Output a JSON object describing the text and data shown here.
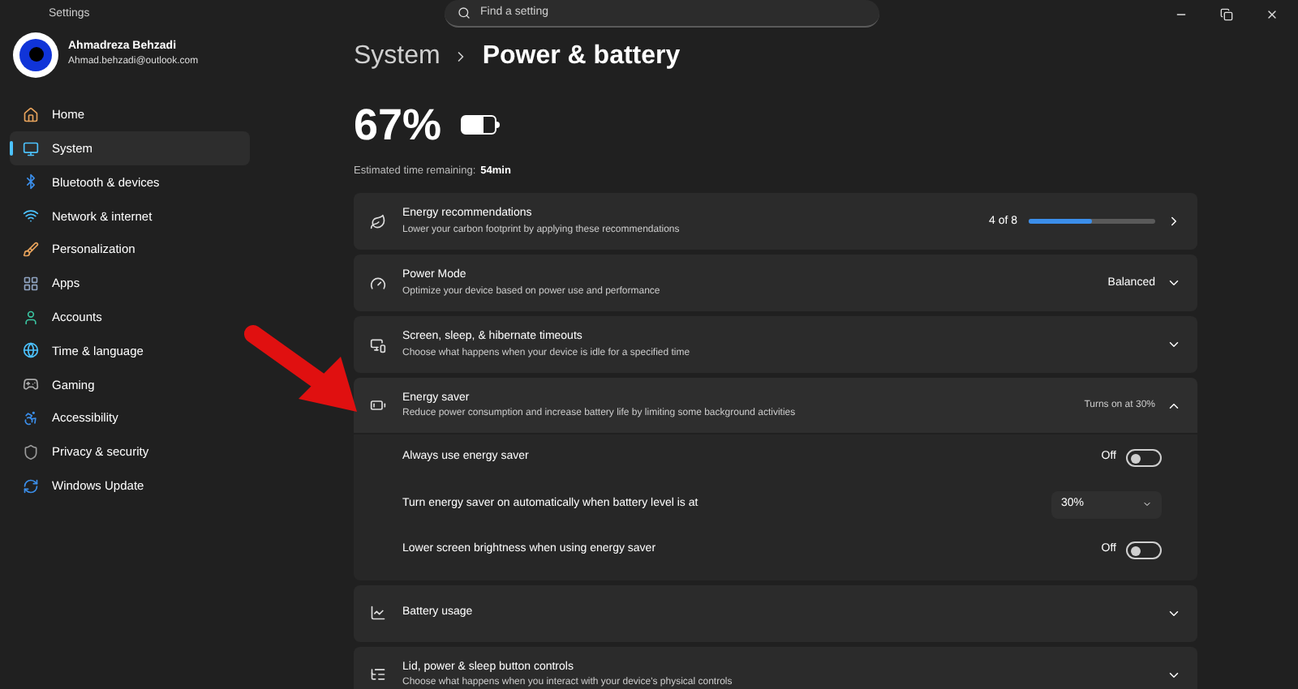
{
  "window": {
    "title": "Settings"
  },
  "user": {
    "name": "Ahmadreza Behzadi",
    "email": "Ahmad.behzadi@outlook.com"
  },
  "search": {
    "placeholder": "Find a setting"
  },
  "sidebar": {
    "items": [
      {
        "label": "Home",
        "selected": false
      },
      {
        "label": "System",
        "selected": true
      },
      {
        "label": "Bluetooth & devices",
        "selected": false
      },
      {
        "label": "Network & internet",
        "selected": false
      },
      {
        "label": "Personalization",
        "selected": false
      },
      {
        "label": "Apps",
        "selected": false
      },
      {
        "label": "Accounts",
        "selected": false
      },
      {
        "label": "Time & language",
        "selected": false
      },
      {
        "label": "Gaming",
        "selected": false
      },
      {
        "label": "Accessibility",
        "selected": false
      },
      {
        "label": "Privacy & security",
        "selected": false
      },
      {
        "label": "Windows Update",
        "selected": false
      }
    ]
  },
  "breadcrumb": {
    "parent": "System",
    "current": "Power & battery"
  },
  "battery": {
    "percent": "67%",
    "level": 0.67,
    "estimate_label": "Estimated time remaining:",
    "estimate_value": "54min"
  },
  "cards": [
    {
      "kind": "progress",
      "title": "Energy recommendations",
      "subtitle": "Lower your carbon footprint by applying these recommendations",
      "value": "4 of 8",
      "level": 0.5
    },
    {
      "kind": "dropdown",
      "title": "Power Mode",
      "subtitle": "Optimize your device based on power use and performance",
      "value": "Balanced",
      "expanded": false
    },
    {
      "kind": "dropdown",
      "title": "Screen, sleep, & hibernate timeouts",
      "subtitle": "Choose what happens when your device is idle for a specified time",
      "expanded": false
    },
    {
      "kind": "dropdown",
      "title": "Energy saver",
      "subtitle": "Reduce power consumption and increase battery life by limiting some background activities",
      "value": "Turns on at 30%",
      "expanded": true,
      "settings": [
        {
          "kind": "toggle",
          "label": "Always use energy saver",
          "state_label": "Off",
          "on": false
        },
        {
          "kind": "select",
          "label": "Turn energy saver on automatically when battery level is at",
          "value": "30%"
        },
        {
          "kind": "toggle",
          "label": "Lower screen brightness when using energy saver",
          "state_label": "Off",
          "on": false
        }
      ]
    },
    {
      "kind": "dropdown",
      "title": "Battery usage",
      "expanded": false
    },
    {
      "kind": "dropdown",
      "title": "Lid, power & sleep button controls",
      "subtitle": "Choose what happens when you interact with your device's physical controls",
      "expanded": false
    }
  ]
}
